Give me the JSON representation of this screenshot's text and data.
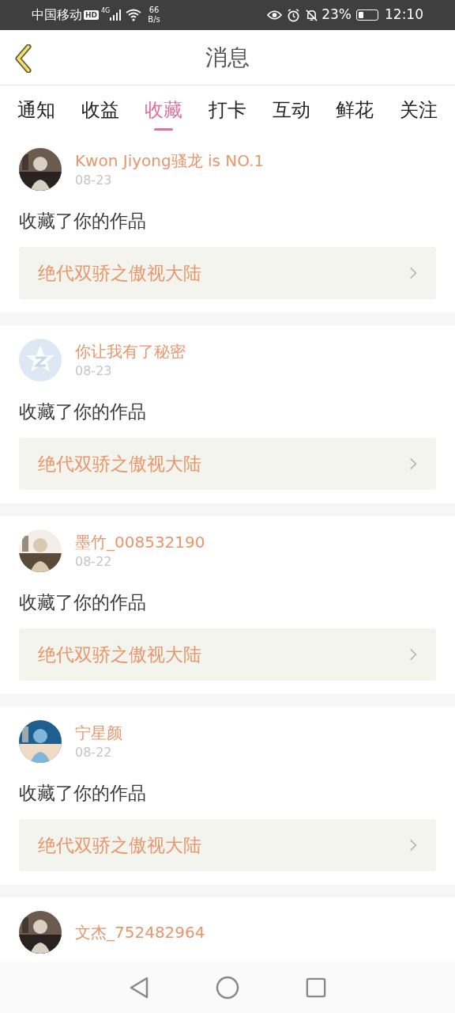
{
  "status_bar": {
    "carrier": "中国移动",
    "hd": "HD",
    "network": "4G",
    "speed_value": "66",
    "speed_unit": "B/s",
    "battery_text": "23%",
    "time": "12:10"
  },
  "header": {
    "title": "消息"
  },
  "tabs": [
    {
      "label": "通知",
      "selected": false
    },
    {
      "label": "收益",
      "selected": false
    },
    {
      "label": "收藏",
      "selected": true
    },
    {
      "label": "打卡",
      "selected": false
    },
    {
      "label": "互动",
      "selected": false
    },
    {
      "label": "鲜花",
      "selected": false
    },
    {
      "label": "关注",
      "selected": false
    }
  ],
  "messages": [
    {
      "name": "Kwon Jiyong骚龙 is NO.1",
      "date": "08-23",
      "action": "收藏了你的作品",
      "work": "绝代双骄之傲视大陆"
    },
    {
      "avatar": {
        "kind": "default"
      },
      "name": "你让我有了秘密",
      "date": "08-23",
      "action": "收藏了你的作品",
      "work": "绝代双骄之傲视大陆"
    },
    {
      "name": "墨竹_008532190",
      "date": "08-22",
      "action": "收藏了你的作品",
      "work": "绝代双骄之傲视大陆"
    },
    {
      "name": "宁星颜",
      "date": "08-22",
      "action": "收藏了你的作品",
      "work": "绝代双骄之傲视大陆"
    },
    {
      "name": "文杰_752482964"
    }
  ]
}
